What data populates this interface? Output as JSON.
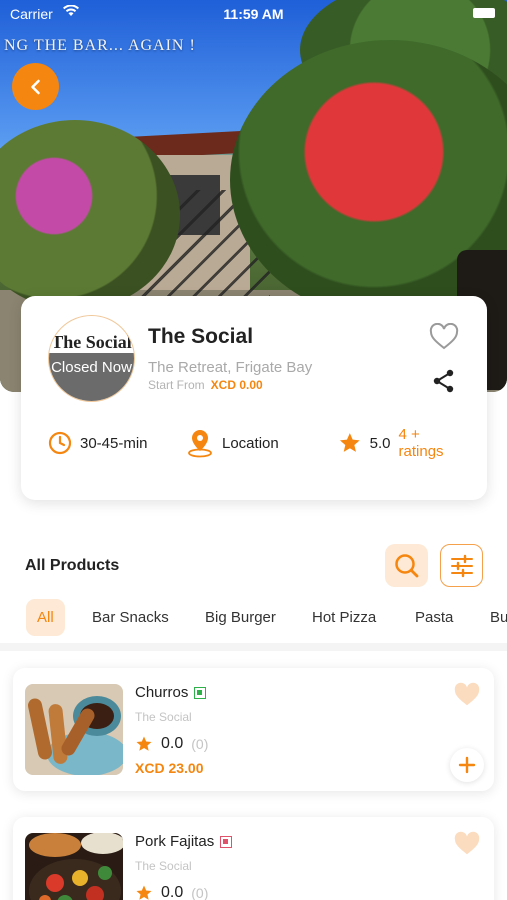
{
  "status_bar": {
    "carrier": "Carrier",
    "time": "11:59 AM"
  },
  "hero": {
    "marquee_text": "NG THE  BAR... AGAIN !"
  },
  "store": {
    "logo_text": "The Social",
    "closed_label": "Closed Now",
    "name": "The Social",
    "address": "The Retreat, Frigate Bay",
    "start_from_label": "Start From",
    "start_price": "XCD 0.00",
    "delivery_time": "30-45-min",
    "location_label": "Location",
    "rating": "5.0",
    "ratings_count": "4 + ratings"
  },
  "products_section": {
    "title": "All Products",
    "categories": [
      "All",
      "Bar Snacks",
      "Big Burger",
      "Hot Pizza",
      "Pasta",
      "Bu"
    ],
    "active_category": "All"
  },
  "products": [
    {
      "name": "Churros",
      "veg_type": "veg",
      "store": "The Social",
      "rating": "0.0",
      "rating_count": "(0)",
      "price": "XCD 23.00"
    },
    {
      "name": "Pork Fajitas",
      "veg_type": "non-veg",
      "store": "The Social",
      "rating": "0.0",
      "rating_count": "(0)",
      "price": ""
    }
  ],
  "colors": {
    "accent": "#f5860f",
    "accent_light": "#fde9d5",
    "veg": "#2fb14a",
    "non_veg": "#e0516a"
  }
}
